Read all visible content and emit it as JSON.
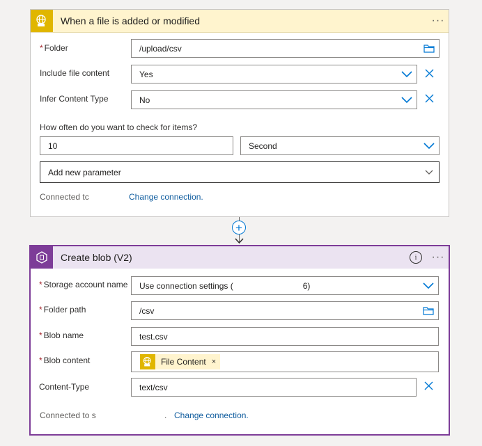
{
  "trigger": {
    "title": "When a file is added or modified",
    "more": "···",
    "folder_label": "Folder",
    "folder_value": "/upload/csv",
    "include_content_label": "Include file content",
    "include_content_value": "Yes",
    "infer_type_label": "Infer Content Type",
    "infer_type_value": "No",
    "check_question": "How often do you want to check for items?",
    "interval_value": "10",
    "frequency_value": "Second",
    "add_param_label": "Add new parameter",
    "connected_label": "Connected tc",
    "change_connection": "Change connection."
  },
  "action": {
    "title": "Create blob (V2)",
    "info": "i",
    "more": "···",
    "storage_label": "Storage account name",
    "storage_value": "Use connection settings (                              6)",
    "folder_path_label": "Folder path",
    "folder_path_value": "/csv",
    "blob_name_label": "Blob name",
    "blob_name_value": "test.csv",
    "blob_content_label": "Blob content",
    "token_label": "File Content",
    "token_close": "×",
    "content_type_label": "Content-Type",
    "content_type_value": "text/csv",
    "connected_label": "Connected to s",
    "connected_extra": ".",
    "change_connection": "Change connection."
  },
  "connector": {
    "plus": "+"
  },
  "colors": {
    "trigger_accent": "#e0b600",
    "action_accent": "#7d3c98",
    "link": "#0f5c9e",
    "required": "#a4262c"
  },
  "icons": [
    "ftp-globe-icon",
    "storage-blob-icon",
    "chevron-down-icon",
    "folder-icon",
    "close-icon",
    "info-icon",
    "more-icon",
    "plus-icon"
  ]
}
